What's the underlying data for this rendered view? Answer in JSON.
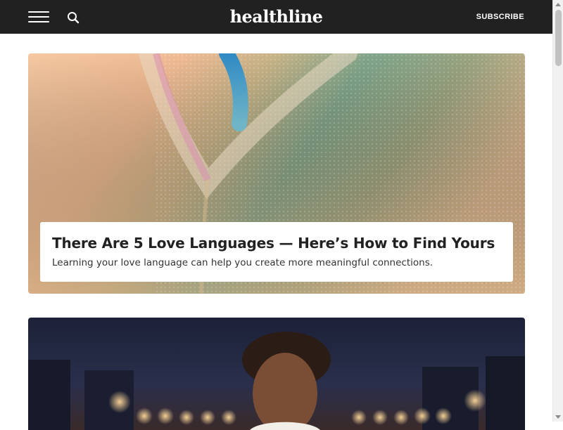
{
  "header": {
    "logo": "healthline",
    "subscribe_label": "SUBSCRIBE",
    "menu_icon": "hamburger-menu-icon",
    "search_icon": "search-icon",
    "background": "#222121"
  },
  "articles": [
    {
      "title": "There Are 5 Love Languages — Here’s How to Find Yours",
      "description": "Learning your love language can help you create more meaningful connections."
    },
    {
      "image": "portrait-photo"
    }
  ]
}
